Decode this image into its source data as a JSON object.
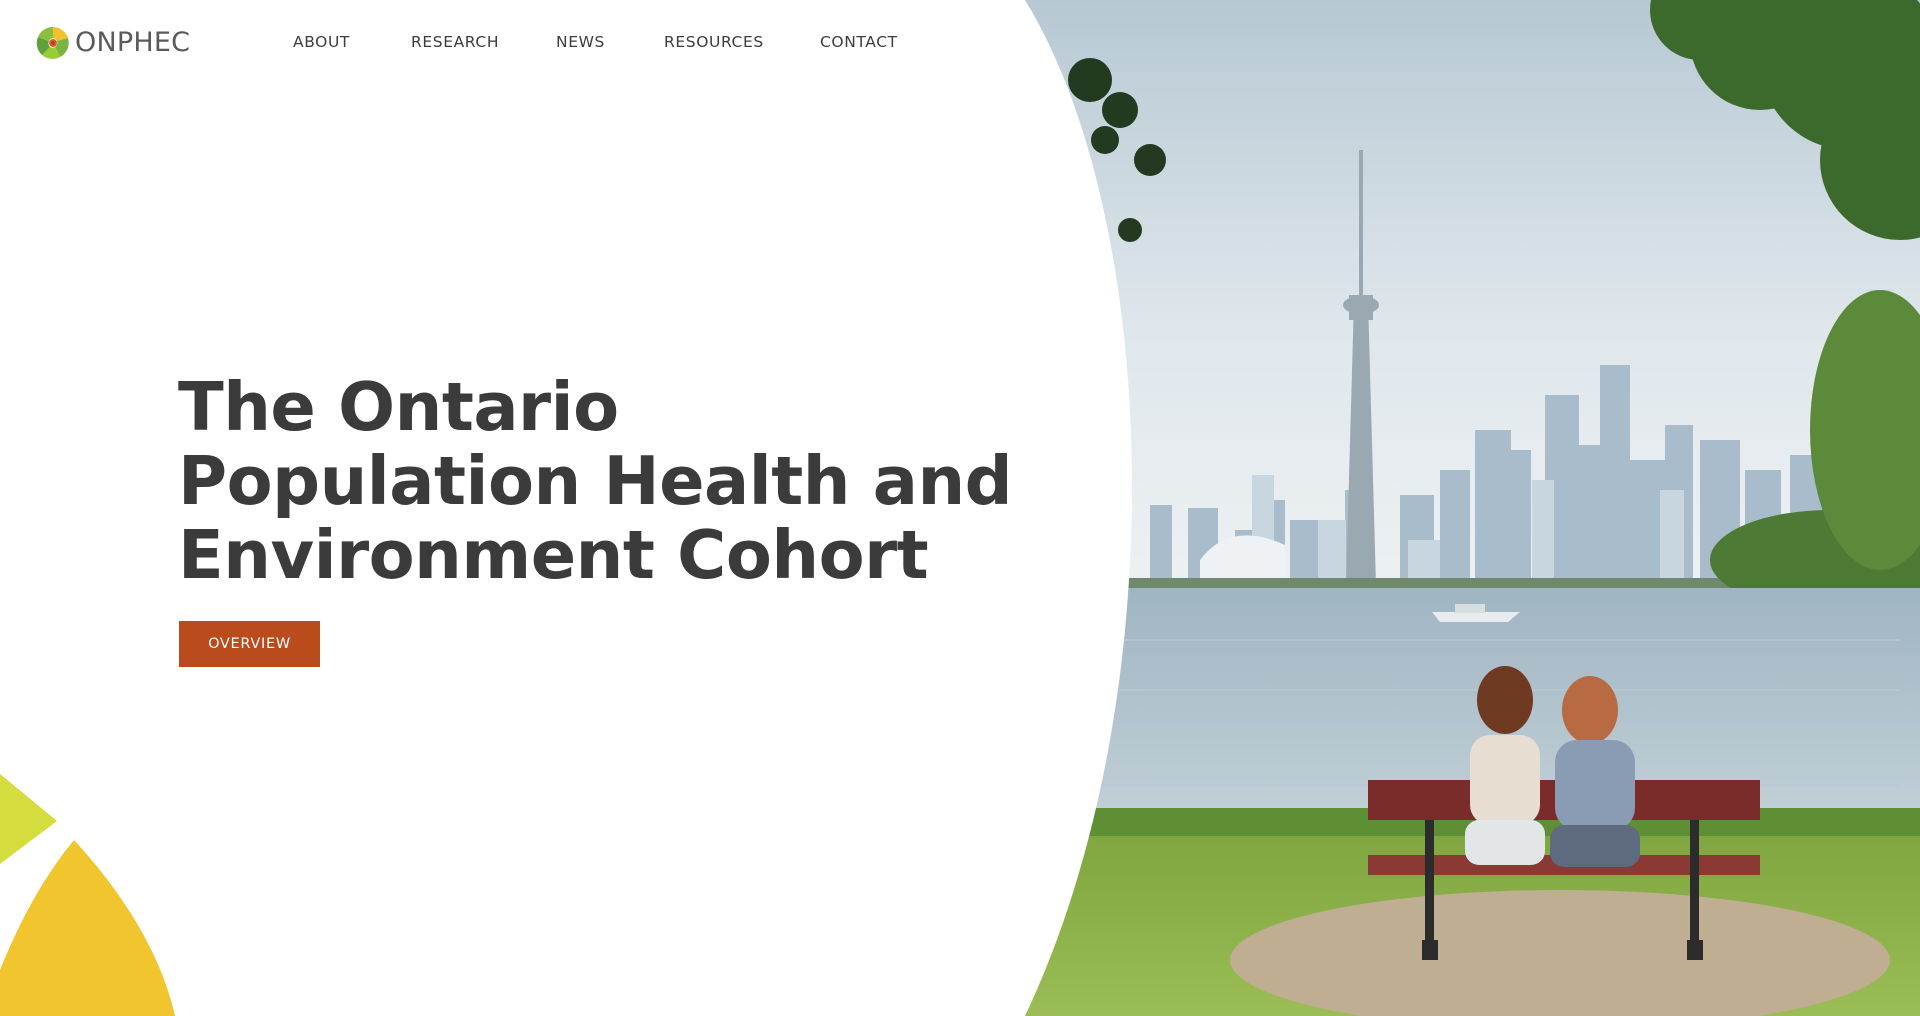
{
  "brand": {
    "name": "ONPHEC",
    "colors": {
      "logo_green": "#7cb342",
      "logo_yellow": "#f2c12e",
      "logo_orange": "#d4662a",
      "logo_red": "#c0392b"
    }
  },
  "nav": {
    "items": [
      {
        "label": "ABOUT"
      },
      {
        "label": "RESEARCH"
      },
      {
        "label": "NEWS"
      },
      {
        "label": "RESOURCES"
      },
      {
        "label": "CONTACT"
      }
    ]
  },
  "hero": {
    "title_lines": [
      "The Ontario",
      "Population Health and",
      "Environment Cohort"
    ],
    "button_label": "OVERVIEW",
    "colors": {
      "button": "#b94b1d",
      "title": "#3b3b3b",
      "leaf_lime": "#d4dc3e",
      "leaf_yellow": "#f0c52e"
    }
  }
}
